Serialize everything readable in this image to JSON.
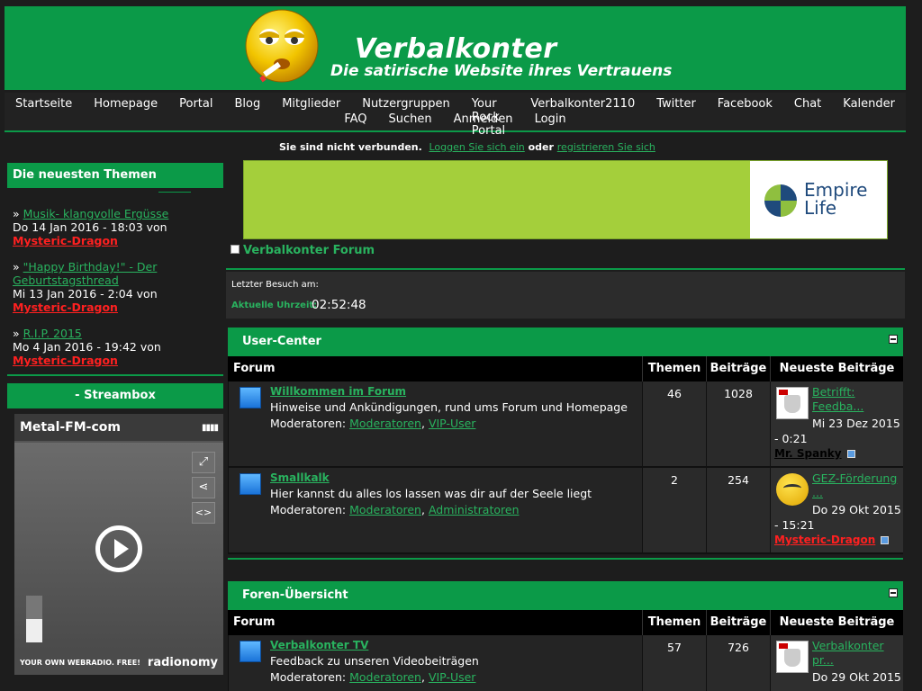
{
  "header": {
    "title": "Verbalkonter",
    "subtitle": "Die satirische Website ihres Vertrauens"
  },
  "nav": {
    "row1": [
      "Startseite",
      "Homepage",
      "Portal",
      "Blog",
      "Mitglieder",
      "Nutzergruppen",
      "Your Rock Portal",
      "Verbalkonter2110",
      "Twitter",
      "Facebook",
      "Chat",
      "Kalender"
    ],
    "row2": [
      "FAQ",
      "Suchen",
      "Anmelden",
      "Login"
    ]
  },
  "status": {
    "text": "Sie sind nicht verbunden.",
    "login_link": "Loggen Sie sich ein",
    "or": "oder",
    "register_link": "registrieren Sie sich"
  },
  "sidebar": {
    "latest_title": "Die neuesten Themen",
    "topics": [
      {
        "prefix": "» ",
        "title": "Musik- klangvolle Ergüsse",
        "date": "Do 14 Jan 2016 - 18:03 von ",
        "user": "Mysteric-Dragon"
      },
      {
        "prefix": "» ",
        "title": "\"Happy Birthday!\" - Der Geburtstagsthread",
        "date": "Mi 13 Jan 2016 - 2:04 von ",
        "user": "Mysteric-Dragon"
      },
      {
        "prefix": "» ",
        "title": "R.I.P. 2015",
        "date": "Mo 4 Jan 2016 - 19:42 von ",
        "user": "Mysteric-Dragon"
      }
    ],
    "streambox_title": "- Streambox",
    "player": {
      "station": "Metal-FM-com",
      "footer_left": "YOUR OWN WEBRADIO. FREE!",
      "footer_right": "radionomy",
      "volume_level": 0.5
    }
  },
  "ad": {
    "brand_line1": "Empire",
    "brand_line2": "Life"
  },
  "breadcrumb": "Verbalkonter Forum",
  "visit": {
    "last_visit_label": "Letzter Besuch am:",
    "current_time_label": "Aktuelle Uhrzeit:",
    "current_time": "02:52:48"
  },
  "columns": {
    "forum": "Forum",
    "themen": "Themen",
    "beitraege": "Beiträge",
    "newest": "Neueste Beiträge"
  },
  "sections": [
    {
      "title": "User-Center",
      "forums": [
        {
          "title": "Willkommen im Forum",
          "description": "Hinweise und Ankündigungen, rund ums Forum und Homepage",
          "mods_label": "Moderatoren:",
          "mods": [
            "Moderatoren",
            "VIP-User"
          ],
          "themen": "46",
          "beitraege": "1028",
          "latest": {
            "link": "Betrifft: Feedba...",
            "date": "Mi 23 Dez 2015",
            "time": "- 0:21",
            "user": "Mr. Spanky"
          }
        },
        {
          "title": "Smallkalk",
          "description": "Hier kannst du alles los lassen was dir auf der Seele liegt",
          "mods_label": "Moderatoren:",
          "mods": [
            "Moderatoren",
            "Administratoren"
          ],
          "themen": "2",
          "beitraege": "254",
          "latest": {
            "link": "GEZ-Förderung ...",
            "date": "Do 29 Okt 2015",
            "time": "- 15:21",
            "user": "Mysteric-Dragon"
          }
        }
      ]
    },
    {
      "title": "Foren-Übersicht",
      "forums": [
        {
          "title": "Verbalkonter TV",
          "description": "Feedback zu unseren Videobeiträgen",
          "mods_label": "Moderatoren:",
          "mods": [
            "Moderatoren",
            "VIP-User"
          ],
          "themen": "57",
          "beitraege": "726",
          "latest": {
            "link": "Verbalkonter pr...",
            "date": "Do 29 Okt 2015",
            "time": "",
            "user": ""
          }
        }
      ]
    }
  ]
}
